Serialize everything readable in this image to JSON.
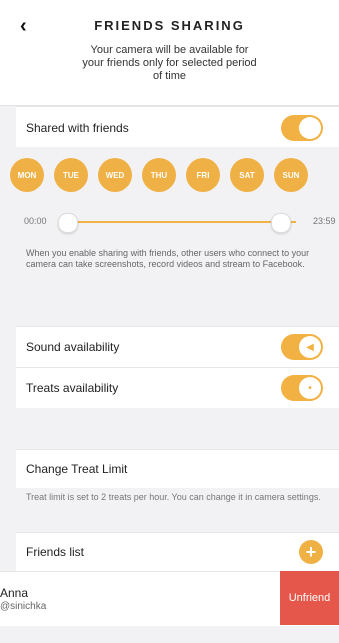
{
  "header": {
    "title": "FRIENDS SHARING",
    "subtitle": "Your camera will be available for your friends only for selected period of time"
  },
  "sharing": {
    "label": "Shared with friends",
    "enabled": true,
    "days": [
      "MON",
      "TUE",
      "WED",
      "THU",
      "FRI",
      "SAT",
      "SUN"
    ],
    "time_start": "00:00",
    "time_end": "23:59",
    "info": "When you enable sharing with friends, other users who connect to your camera can take screenshots, record videos and stream to Facebook."
  },
  "availability": {
    "sound_label": "Sound availability",
    "treats_label": "Treats availability",
    "sound_enabled": true,
    "treats_enabled": true
  },
  "treat_limit": {
    "label": "Change Treat Limit",
    "info": "Treat limit is set to 2 treats per hour. You can change it in camera settings."
  },
  "friends": {
    "label": "Friends list",
    "items": [
      {
        "name": "Anna",
        "handle": "@sinichka",
        "action": "Unfriend"
      }
    ]
  },
  "colors": {
    "accent": "#f0b144",
    "danger": "#e4574a",
    "background": "#f2f2f4"
  },
  "icons": {
    "back": "chevron-left-icon",
    "sound": "speaker-icon",
    "treat": "bone-icon",
    "add": "plus-icon"
  }
}
